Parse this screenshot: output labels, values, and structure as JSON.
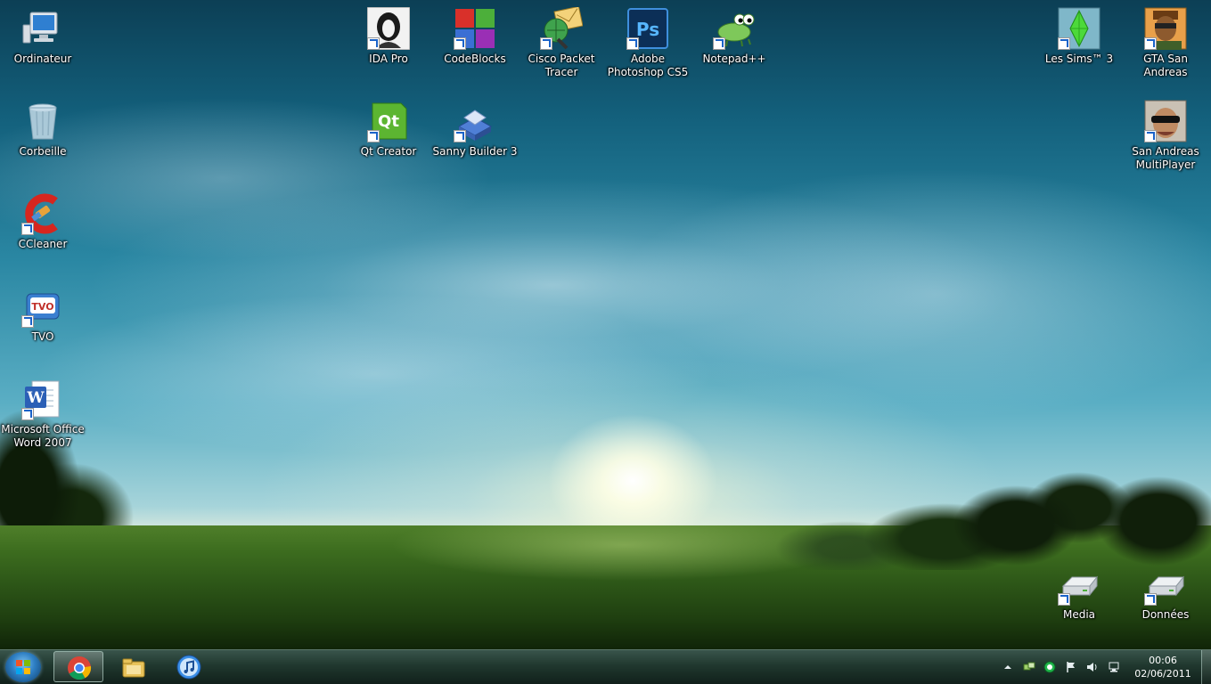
{
  "desktop": {
    "icons": {
      "ordinateur": "Ordinateur",
      "corbeille": "Corbeille",
      "ccleaner": "CCleaner",
      "tvo": "TVO",
      "word": "Microsoft Office\nWord 2007",
      "idapro": "IDA Pro",
      "codeblocks": "CodeBlocks",
      "cisco": "Cisco Packet\nTracer",
      "photoshop": "Adobe\nPhotoshop CS5",
      "notepad": "Notepad++",
      "qtcreator": "Qt Creator",
      "sanny": "Sanny Builder 3",
      "sims": "Les Sims™ 3",
      "gtasa": "GTA San Andreas",
      "samp": "San Andreas\nMultiPlayer",
      "media": "Media",
      "donnees": "Données"
    }
  },
  "taskbar": {
    "pinned": [
      "chrome-icon",
      "windows-explorer-icon",
      "itunes-icon"
    ],
    "tray_icons": [
      "show-hidden-icons",
      "network-activity-icon",
      "app-status-icon",
      "action-center-flag-icon",
      "volume-icon",
      "network-icon"
    ],
    "clock": {
      "time": "00:06",
      "date": "02/06/2011"
    }
  },
  "colors": {
    "taskbar": "#14301f",
    "icon_label": "#ffffff",
    "sky": "#2a87a3",
    "grass": "#3d6d1f"
  }
}
